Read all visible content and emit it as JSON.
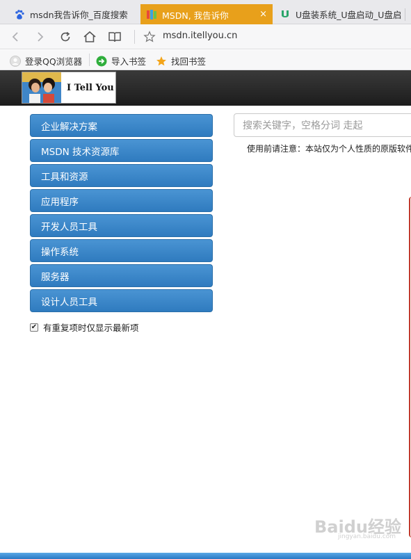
{
  "browser": {
    "tabs": [
      {
        "title": "msdn我告诉你_百度搜索",
        "icon": "baidu-paw-icon",
        "active": false
      },
      {
        "title": "MSDN, 我告诉你",
        "icon": "msdn-site-icon",
        "active": true
      },
      {
        "title": "U盘装系统_U盘启动_U盘启",
        "icon": "u-disk-icon",
        "active": false
      }
    ],
    "close_glyph": "×",
    "url": "msdn.itellyou.cn",
    "accent_color": "#e8a01b",
    "bookmarks": [
      {
        "label": "登录QQ浏览器",
        "icon": "user-avatar-icon"
      },
      {
        "label": "导入书签",
        "icon": "import-arrow-icon"
      },
      {
        "label": "找回书签",
        "icon": "star-icon"
      }
    ]
  },
  "site": {
    "logo_text": "I Tell You",
    "menu": [
      "企业解决方案",
      "MSDN 技术资源库",
      "工具和资源",
      "应用程序",
      "开发人员工具",
      "操作系统",
      "服务器",
      "设计人员工具"
    ],
    "menu_color": "#3a86c8",
    "checkbox_label": "有重复项时仅显示最新项",
    "checkbox_checked": true,
    "search_placeholder": "搜索关键字，空格分词 走起",
    "notice": "使用前请注意：本站仅为个人性质的原版软件"
  },
  "watermark": {
    "brand": "Baidu经验",
    "domain": "jingyan.baidu.com"
  }
}
